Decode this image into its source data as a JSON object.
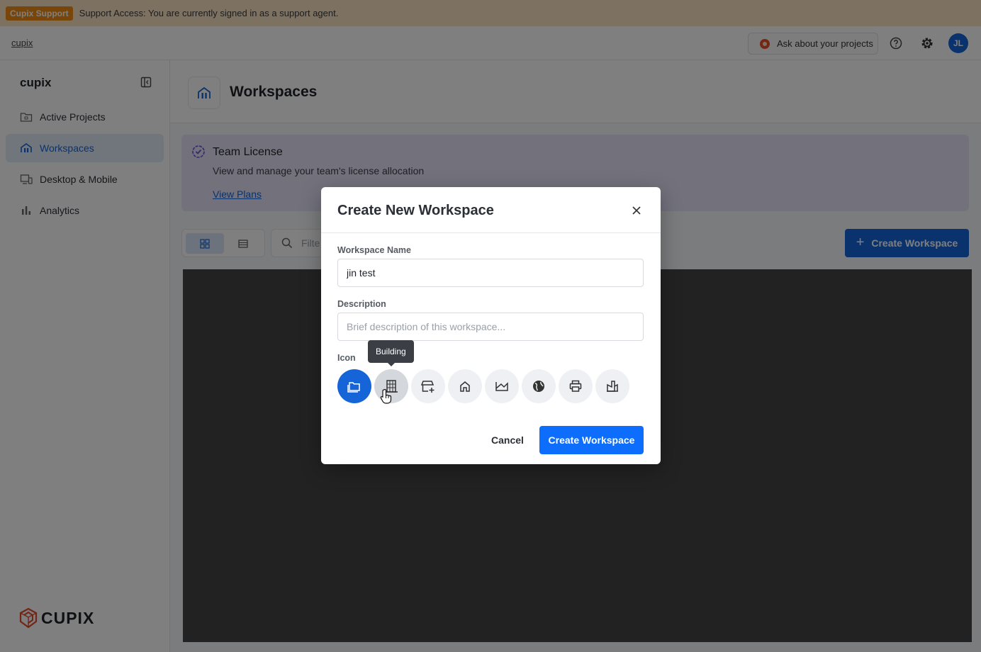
{
  "banner": {
    "badge": "Cupix Support",
    "text": "Support Access: You are currently signed in as a support agent."
  },
  "topbar": {
    "breadcrumb": "cupix",
    "ask_label": "Ask about your projects",
    "help_icon": "help-circle-icon",
    "settings_icon": "gear-icon",
    "avatar_initials": "JL"
  },
  "sidebar": {
    "title": "cupix",
    "items": [
      {
        "label": "Active Projects",
        "icon": "folder-icon",
        "active": false
      },
      {
        "label": "Workspaces",
        "icon": "workspace-icon",
        "active": true
      },
      {
        "label": "Desktop & Mobile",
        "icon": "devices-icon",
        "active": false
      },
      {
        "label": "Analytics",
        "icon": "bar-chart-icon",
        "active": false
      }
    ],
    "brand": "CUPIX"
  },
  "header": {
    "title": "Workspaces"
  },
  "license": {
    "title": "Team License",
    "description": "View and manage your team's license allocation",
    "link": "View Plans"
  },
  "toolbar": {
    "filter_placeholder": "Filte",
    "create_label": "Create Workspace"
  },
  "modal": {
    "title": "Create New Workspace",
    "name_label": "Workspace Name",
    "name_value": "jin test",
    "description_label": "Description",
    "description_placeholder": "Brief description of this workspace...",
    "icon_label": "Icon",
    "icons": [
      "folder-icon",
      "building-icon",
      "store-icon",
      "home-icon",
      "landscape-icon",
      "globe-icon",
      "printer-icon",
      "factory-icon"
    ],
    "selected_icon": "folder-icon",
    "tooltip": "Building",
    "cancel_label": "Cancel",
    "create_label": "Create Workspace"
  },
  "colors": {
    "accent": "#1565d8",
    "banner_bg": "#fbe3c4",
    "badge": "#f08c14",
    "license_bg": "#e6e3f8"
  }
}
